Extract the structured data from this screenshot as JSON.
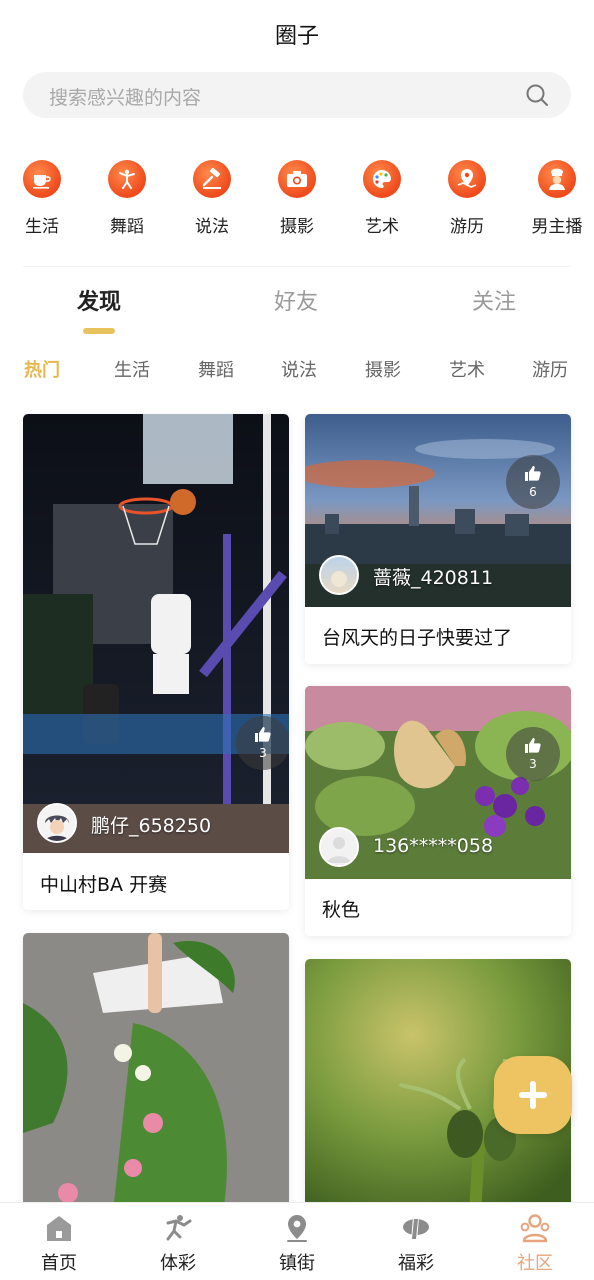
{
  "header": {
    "title": "圈子"
  },
  "search": {
    "placeholder": "搜索感兴趣的内容"
  },
  "categories": [
    {
      "label": "生活",
      "icon": "coffee-cup-icon"
    },
    {
      "label": "舞蹈",
      "icon": "dancer-icon"
    },
    {
      "label": "说法",
      "icon": "gavel-icon"
    },
    {
      "label": "摄影",
      "icon": "camera-icon"
    },
    {
      "label": "艺术",
      "icon": "palette-icon"
    },
    {
      "label": "游历",
      "icon": "map-pin-icon"
    },
    {
      "label": "男主播",
      "icon": "chef-avatar-icon"
    }
  ],
  "tabs": [
    {
      "label": "发现",
      "active": true
    },
    {
      "label": "好友",
      "active": false
    },
    {
      "label": "关注",
      "active": false
    }
  ],
  "subtabs": [
    {
      "label": "热门",
      "active": true
    },
    {
      "label": "生活"
    },
    {
      "label": "舞蹈"
    },
    {
      "label": "说法"
    },
    {
      "label": "摄影"
    },
    {
      "label": "艺术"
    },
    {
      "label": "游历"
    }
  ],
  "posts": [
    {
      "caption": "中山村BA 开赛",
      "user": "鹏仔_658250",
      "likes": "3"
    },
    {
      "caption": "台风天的日子快要过了",
      "user": "蔷薇_420811",
      "likes": "6"
    },
    {
      "caption": "秋色",
      "user": "136*****058",
      "likes": "3"
    }
  ],
  "bottom_nav": [
    {
      "label": "首页",
      "icon": "home-icon"
    },
    {
      "label": "体彩",
      "icon": "sports-lottery-icon"
    },
    {
      "label": "镇街",
      "icon": "location-pin-icon"
    },
    {
      "label": "福彩",
      "icon": "welfare-lottery-icon"
    },
    {
      "label": "社区",
      "icon": "community-icon",
      "active": true
    }
  ],
  "colors": {
    "accent": "#e6b74e",
    "fab": "#eec463",
    "category_icon": "#ef4a1c",
    "active_nav": "#e6a57d"
  }
}
